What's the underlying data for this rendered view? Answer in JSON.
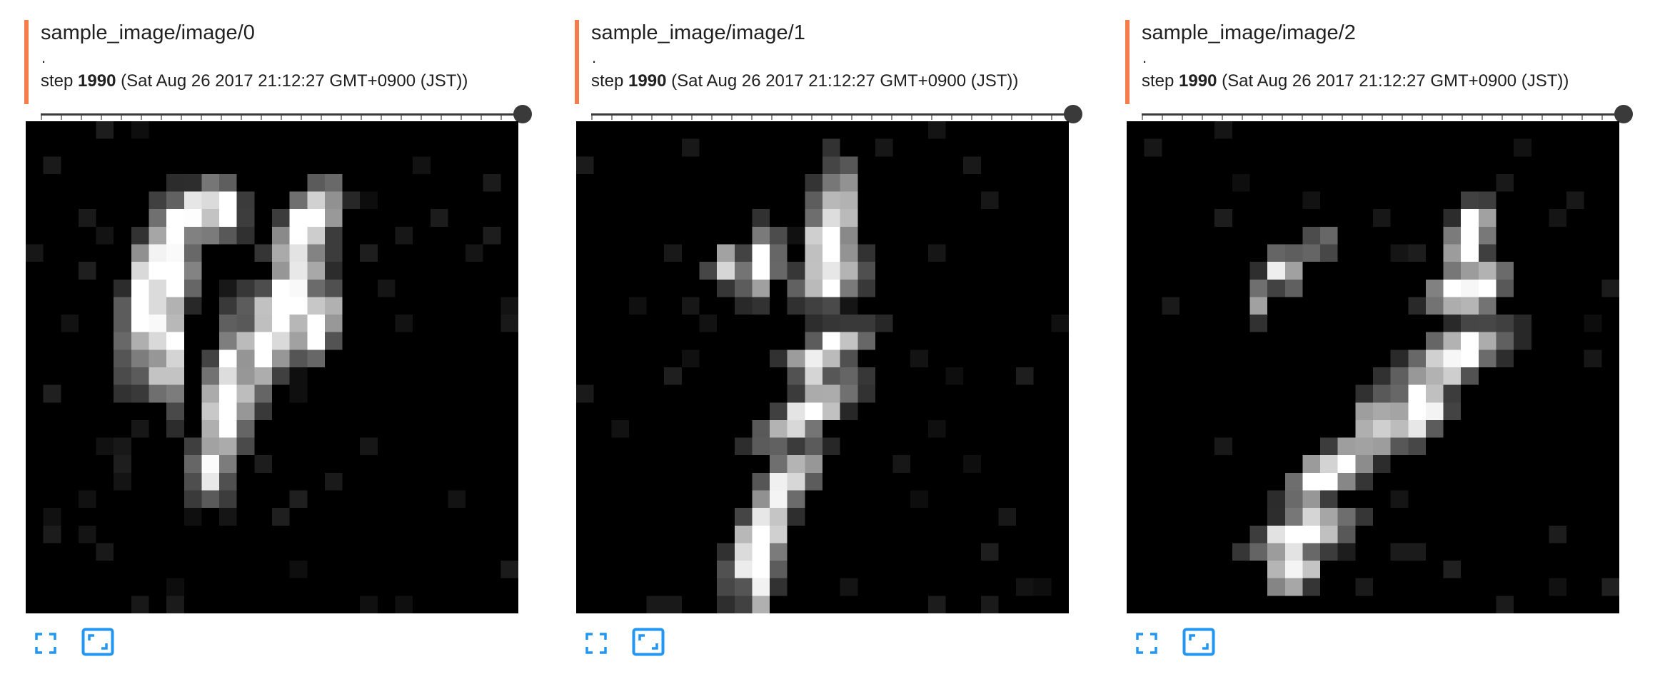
{
  "accent_color": "#f57c4c",
  "icon_color": "#2196f3",
  "cards": [
    {
      "tag": "sample_image/image/0",
      "dot": ".",
      "step_prefix": "step",
      "step_value": "1990",
      "timestamp": "(Sat Aug 26 2017 21:12:27 GMT+0900 (JST))",
      "slider_value": 1.0,
      "icons": [
        "fullscreen-icon",
        "fit-image-icon"
      ],
      "blobs": [
        [
          7,
          10,
          4.2,
          1.1,
          0.2,
          1.0
        ],
        [
          8.5,
          8,
          3.2,
          1.0,
          0.1,
          1.0
        ],
        [
          9,
          5.5,
          1.5,
          1.0,
          0.5,
          1.0
        ],
        [
          11,
          5,
          1.5,
          1.2,
          -0.2,
          1.0
        ],
        [
          8,
          11.5,
          4.0,
          0.9,
          -0.1,
          0.9
        ],
        [
          14.5,
          11,
          5.0,
          1.3,
          0.4,
          1.0
        ],
        [
          16,
          6,
          2.5,
          1.2,
          0.6,
          1.0
        ],
        [
          16.5,
          11.5,
          2.0,
          1.1,
          0.3,
          1.0
        ],
        [
          11.5,
          16,
          4.5,
          1.1,
          0.15,
          1.0
        ],
        [
          10.5,
          19.5,
          2.0,
          0.9,
          0.15,
          0.8
        ],
        [
          8,
          14.5,
          1.3,
          0.8,
          0,
          0.8
        ]
      ],
      "seed": 7
    },
    {
      "tag": "sample_image/image/1",
      "dot": ".",
      "step_prefix": "step",
      "step_value": "1990",
      "timestamp": "(Sat Aug 26 2017 21:12:27 GMT+0900 (JST))",
      "slider_value": 1.0,
      "icons": [
        "fullscreen-icon",
        "fit-image-icon"
      ],
      "blobs": [
        [
          14.5,
          6.5,
          3.5,
          1.2,
          0.1,
          1.0
        ],
        [
          10.5,
          8,
          2.0,
          1.0,
          0.2,
          0.8
        ],
        [
          8.5,
          8.2,
          1.0,
          0.8,
          0,
          0.9
        ],
        [
          14.5,
          9,
          1.8,
          1.2,
          1.2,
          0.9
        ],
        [
          14.3,
          13,
          2.3,
          0.8,
          1.2,
          0.9
        ],
        [
          13.3,
          16.5,
          3.0,
          0.9,
          1.0,
          0.9
        ],
        [
          12,
          20.5,
          2.3,
          1.0,
          0.7,
          0.9
        ],
        [
          10.5,
          23.5,
          3.0,
          1.1,
          0.4,
          1.0
        ],
        [
          10.5,
          25.3,
          2.6,
          0.9,
          0.1,
          0.9
        ],
        [
          13.5,
          14.5,
          1.5,
          1.0,
          0.3,
          0.6
        ]
      ],
      "seed": 21
    },
    {
      "tag": "sample_image/image/2",
      "dot": ".",
      "step_prefix": "step",
      "step_value": "1990",
      "timestamp": "(Sat Aug 26 2017 21:12:27 GMT+0900 (JST))",
      "slider_value": 1.0,
      "icons": [
        "fullscreen-icon",
        "fit-image-icon"
      ],
      "blobs": [
        [
          19.5,
          6.5,
          1.8,
          1.0,
          0.5,
          1.0
        ],
        [
          19.5,
          9.5,
          2.0,
          1.2,
          1.2,
          1.0
        ],
        [
          18.5,
          13.5,
          3.0,
          1.1,
          1.1,
          1.0
        ],
        [
          16.5,
          16.5,
          2.0,
          1.3,
          0.6,
          1.0
        ],
        [
          14,
          17.5,
          2.2,
          0.9,
          0.2,
          0.8
        ],
        [
          11.5,
          20,
          2.5,
          1.0,
          1.0,
          1.0
        ],
        [
          10,
          23.5,
          2.5,
          1.1,
          1.2,
          1.0
        ],
        [
          9.5,
          25.5,
          1.5,
          1.0,
          0.9,
          0.9
        ],
        [
          9,
          8.5,
          1.0,
          0.8,
          0,
          0.9
        ],
        [
          11,
          7,
          0.8,
          0.7,
          0,
          0.6
        ],
        [
          7.5,
          10,
          1.2,
          0.7,
          0,
          0.5
        ]
      ],
      "seed": 42
    }
  ]
}
